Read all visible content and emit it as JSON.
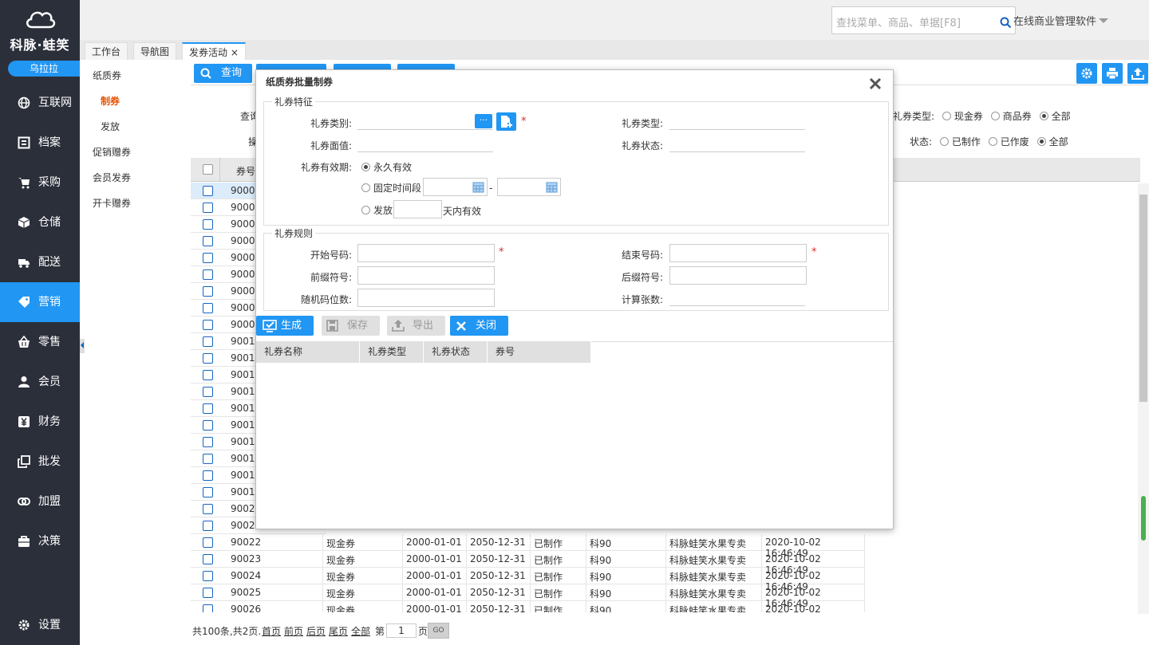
{
  "app": {
    "logo_text": "科脉·蛙笑",
    "user": "乌拉拉",
    "search_placeholder": "查找菜单、商品、单据[F8]",
    "brand": "在线商业管理软件"
  },
  "nav": [
    {
      "label": "互联网",
      "icon": "globe-icon"
    },
    {
      "label": "档案",
      "icon": "archive-icon"
    },
    {
      "label": "采购",
      "icon": "cart-icon"
    },
    {
      "label": "仓储",
      "icon": "box-icon"
    },
    {
      "label": "配送",
      "icon": "truck-icon"
    },
    {
      "label": "营销",
      "icon": "tag-icon",
      "active": true
    },
    {
      "label": "零售",
      "icon": "basket-icon"
    },
    {
      "label": "会员",
      "icon": "user-icon"
    },
    {
      "label": "财务",
      "icon": "yen-icon"
    },
    {
      "label": "批发",
      "icon": "copy-icon"
    },
    {
      "label": "加盟",
      "icon": "link-icon"
    },
    {
      "label": "决策",
      "icon": "briefcase-icon"
    }
  ],
  "settings": "设置",
  "tabs": [
    "工作台",
    "导航图",
    "发券活动"
  ],
  "tab_close": "×",
  "left_menu": [
    {
      "label": "纸质券"
    },
    {
      "label": "制券",
      "active": true
    },
    {
      "label": "发放"
    },
    {
      "label": "促销赠券"
    },
    {
      "label": "会员发券"
    },
    {
      "label": "开卡赠券"
    }
  ],
  "toolbar": {
    "query": "查询",
    "hidden1": "",
    "hidden2": "",
    "hidden3": ""
  },
  "filters": {
    "query_label": "查询",
    "type_label": "礼券类型:",
    "type_options": [
      "现金券",
      "商品券",
      "全部"
    ],
    "status_label": "状态:",
    "status_options": [
      "已制作",
      "已作废",
      "全部"
    ],
    "row2_label": "操"
  },
  "grid": {
    "header_no": "券号",
    "ids": [
      "90001",
      "90002",
      "90003",
      "90004",
      "90005",
      "90006",
      "90007",
      "90008",
      "90009",
      "90010",
      "90011",
      "90012",
      "90013",
      "90014",
      "90015",
      "90016",
      "90017",
      "90018",
      "90019",
      "90020",
      "90021"
    ],
    "rows": [
      {
        "id": "90022",
        "type": "现金券",
        "start": "2000-01-01",
        "end": "2050-12-31",
        "status": "已制作",
        "name": "科90",
        "store": "科脉蛙笑水果专卖",
        "time": "2020-10-02 16:46:49"
      },
      {
        "id": "90023",
        "type": "现金券",
        "start": "2000-01-01",
        "end": "2050-12-31",
        "status": "已制作",
        "name": "科90",
        "store": "科脉蛙笑水果专卖",
        "time": "2020-10-02 16:46:49"
      },
      {
        "id": "90024",
        "type": "现金券",
        "start": "2000-01-01",
        "end": "2050-12-31",
        "status": "已制作",
        "name": "科90",
        "store": "科脉蛙笑水果专卖",
        "time": "2020-10-02 16:46:49"
      },
      {
        "id": "90025",
        "type": "现金券",
        "start": "2000-01-01",
        "end": "2050-12-31",
        "status": "已制作",
        "name": "科90",
        "store": "科脉蛙笑水果专卖",
        "time": "2020-10-02 16:46:49"
      },
      {
        "id": "90026",
        "type": "现金券",
        "start": "2000-01-01",
        "end": "2050-12-31",
        "status": "已制作",
        "name": "科90",
        "store": "科脉蛙笑水果专卖",
        "time": "2020-10-02 16:46:49"
      }
    ]
  },
  "pager": {
    "summary": "共100条,共2页.",
    "first": "首页",
    "prev": "前页",
    "next": "后页",
    "last": "尾页",
    "all": "全部",
    "page_prefix": "第",
    "page_value": "1",
    "page_suffix": "页",
    "go": "GO"
  },
  "dialog": {
    "title": "纸质券批量制券",
    "section1": "礼券特征",
    "category_label": "礼券类别:",
    "category_btn": "···",
    "type_label": "礼券类型:",
    "face_label": "礼券面值:",
    "status_label": "礼券状态:",
    "validity_label": "礼券有效期:",
    "validity_options": [
      "永久有效",
      "固定时间段",
      "发放"
    ],
    "date_sep": "-",
    "days_suffix": "天内有效",
    "section2": "礼券规则",
    "start_label": "开始号码:",
    "end_label": "结束号码:",
    "prefix_label": "前缀符号:",
    "suffix_label": "后缀符号:",
    "random_label": "随机码位数:",
    "count_label": "计算张数:",
    "required": "*",
    "buttons": {
      "generate": "生成",
      "save": "保存",
      "export": "导出",
      "close": "关闭"
    },
    "result_headers": [
      "礼券名称",
      "礼券类型",
      "礼券状态",
      "券号"
    ]
  }
}
